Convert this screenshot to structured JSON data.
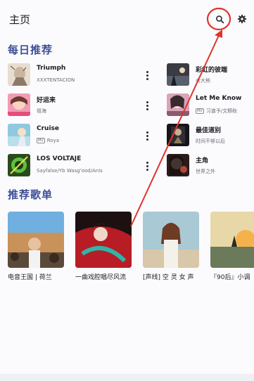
{
  "header": {
    "title": "主页",
    "search_icon": "search-icon",
    "settings_icon": "gear-icon"
  },
  "daily": {
    "title": "每日推荐",
    "left": [
      {
        "title": "Triumph",
        "subtitle": "XXXTENTACION",
        "mv": false
      },
      {
        "title": "好运来",
        "subtitle": "祖海",
        "mv": false
      },
      {
        "title": "Cruise",
        "subtitle": "Roya",
        "mv": true
      },
      {
        "title": "LOS VOLTAJE",
        "subtitle": "Sayfalse/Yb Wasg'ood/Anis",
        "mv": false
      }
    ],
    "right": [
      {
        "title": "彩虹的彼端",
        "subtitle": "仓大熊",
        "mv": false
      },
      {
        "title": "Let Me Know",
        "subtitle": "习谱予/文颢秋",
        "mv": true
      },
      {
        "title": "最佳道别",
        "subtitle": "时间不够以后",
        "mv": false
      },
      {
        "title": "主角",
        "subtitle": "世界之外",
        "mv": false
      }
    ]
  },
  "playlists": {
    "title": "推荐歌单",
    "items": [
      {
        "title": "电音王国 | 荷兰"
      },
      {
        "title": "一曲戏腔唱尽风流"
      },
      {
        "title": "[声线] 空 灵 女 声"
      },
      {
        "title": "『90后』小调"
      }
    ]
  },
  "colors": {
    "accent": "#3d4f96",
    "annotation": "#e0342b"
  }
}
